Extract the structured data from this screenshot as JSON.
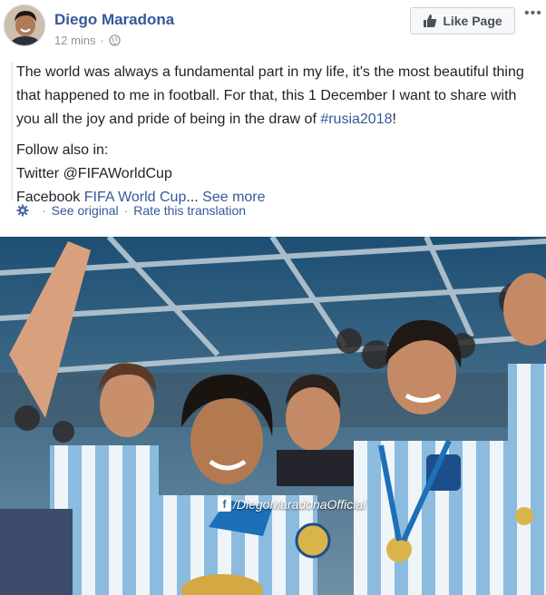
{
  "post": {
    "author": "Diego Maradona",
    "time": "12 mins",
    "separator": "·",
    "like_button_label": "Like Page",
    "more_label": "•••",
    "text_line1": "The world was always a fundamental part in my life, it's the most beautiful thing that happened to me in football. For that, this 1 December I want to share with you all the joy and pride of being in the draw of ",
    "hashtag": "#rusia2018",
    "text_line1_end": "!",
    "follow_label": "Follow also in:",
    "twitter_line": "Twitter @FIFAWorldCup",
    "facebook_prefix": "Facebook ",
    "facebook_link": "FIFA World Cup",
    "ellipsis": "...",
    "see_more": "See more"
  },
  "translation": {
    "see_original": "See original",
    "separator": "·",
    "rate": "Rate this translation"
  },
  "photo": {
    "watermark": "/DiegoMaradonaOfficial",
    "watermark_fb": "f"
  },
  "colors": {
    "link": "#365899",
    "meta": "#90949c",
    "text": "#1d2129"
  },
  "icons": [
    "globe-icon",
    "thumbs-up-icon",
    "gear-icon",
    "facebook-icon"
  ]
}
